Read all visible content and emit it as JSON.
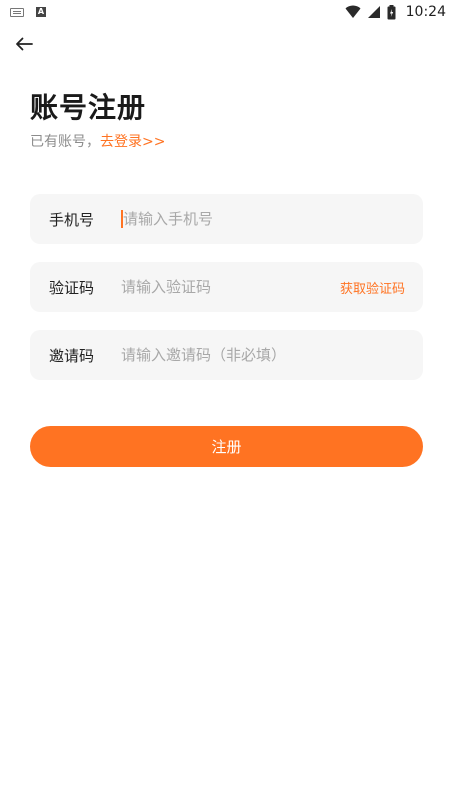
{
  "status_bar": {
    "left_icons": [
      "keyboard-icon",
      "a-letter-icon"
    ],
    "right_icons": [
      "wifi-icon",
      "signal-icon",
      "battery-icon"
    ],
    "time": "10:24"
  },
  "header": {
    "back_icon": "arrow-left-icon"
  },
  "page": {
    "title": "账号注册",
    "hint_prefix": "已有账号，",
    "login_link": "去登录>>"
  },
  "form": {
    "phone": {
      "label": "手机号",
      "placeholder": "请输入手机号",
      "value": ""
    },
    "code": {
      "label": "验证码",
      "placeholder": "请输入验证码",
      "value": "",
      "action": "获取验证码"
    },
    "invite": {
      "label": "邀请码",
      "placeholder": "请输入邀请码（非必填）",
      "value": ""
    }
  },
  "submit": {
    "label": "注册"
  },
  "colors": {
    "accent": "#ff7322",
    "field_bg": "#f6f6f6",
    "title": "#1a1a1a",
    "hint": "#8c8c8c"
  }
}
